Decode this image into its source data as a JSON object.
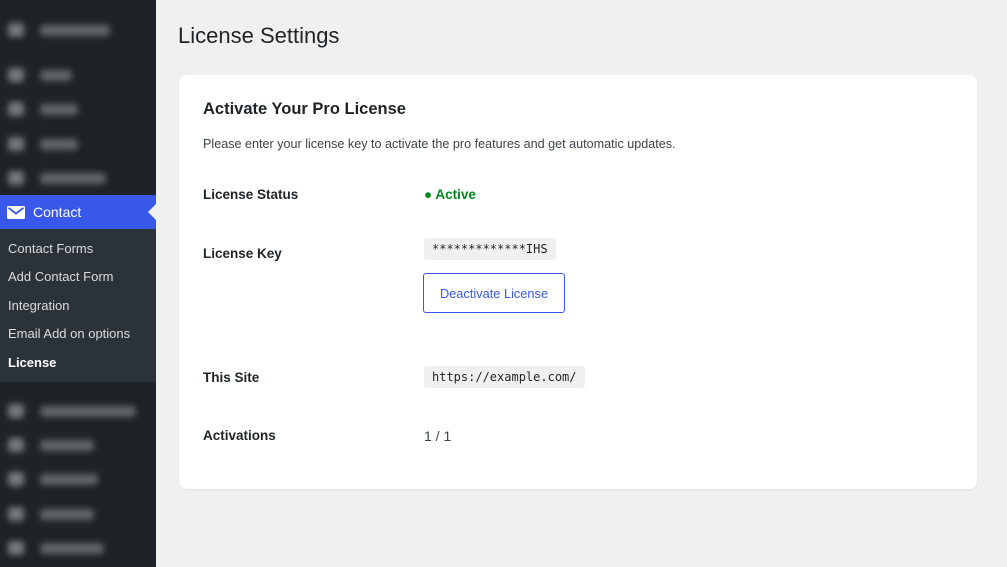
{
  "sidebar": {
    "active_menu": {
      "label": "Contact",
      "icon": "envelope-icon"
    },
    "submenu": [
      {
        "label": "Contact Forms",
        "current": false
      },
      {
        "label": "Add Contact Form",
        "current": false
      },
      {
        "label": "Integration",
        "current": false
      },
      {
        "label": "Email Add on options",
        "current": false
      },
      {
        "label": "License",
        "current": true
      }
    ]
  },
  "page": {
    "title": "License Settings"
  },
  "card": {
    "title": "Activate Your Pro License",
    "description": "Please enter your license key to activate the pro features and get automatic updates.",
    "status_label": "License Status",
    "status_value": "● Active",
    "key_label": "License Key",
    "key_value": "*************IHS",
    "deactivate_label": "Deactivate License",
    "site_label": "This Site",
    "site_value": "https://example.com/",
    "activations_label": "Activations",
    "activations_value": "1 / 1"
  },
  "colors": {
    "accent": "#3858e9",
    "sidebar_bg": "#1d2327",
    "submenu_bg": "#2c3338",
    "status_active": "#008a20",
    "page_bg": "#f0f0f1"
  }
}
